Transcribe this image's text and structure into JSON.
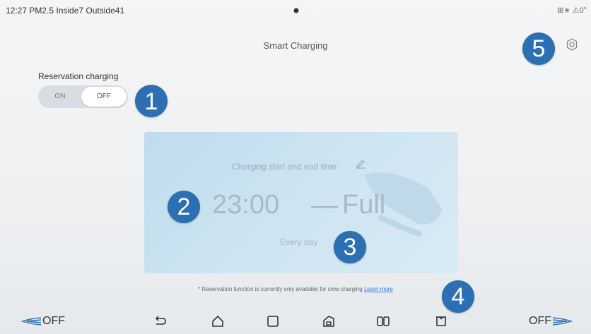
{
  "status": {
    "left_text": "12:27 PM2.5 Inside7 Outside41",
    "right_text": "⊞∗ ⚠0°"
  },
  "header": {
    "title": "Smart Charging"
  },
  "reservation": {
    "label": "Reservation charging",
    "on_label": "ON",
    "off_label": "OFF"
  },
  "schedule": {
    "label": "Charging start and end time",
    "start": "23:00",
    "separator": "—",
    "end": "Full",
    "repeat": "Every day"
  },
  "footer": {
    "note": "* Reservation function is currently only available for slow charging",
    "learn_more": "Learn more"
  },
  "annotations": [
    "1",
    "2",
    "3",
    "4",
    "5"
  ],
  "navbar": {
    "left_label": "OFF",
    "right_label": "OFF",
    "icons": [
      "back-icon",
      "home-icon",
      "recent-apps-icon",
      "car-icon",
      "split-screen-icon",
      "charging-icon"
    ]
  },
  "colors": {
    "badge": "#2c6fb2",
    "card": "#cfe5f2",
    "link": "#3a7bd5"
  }
}
